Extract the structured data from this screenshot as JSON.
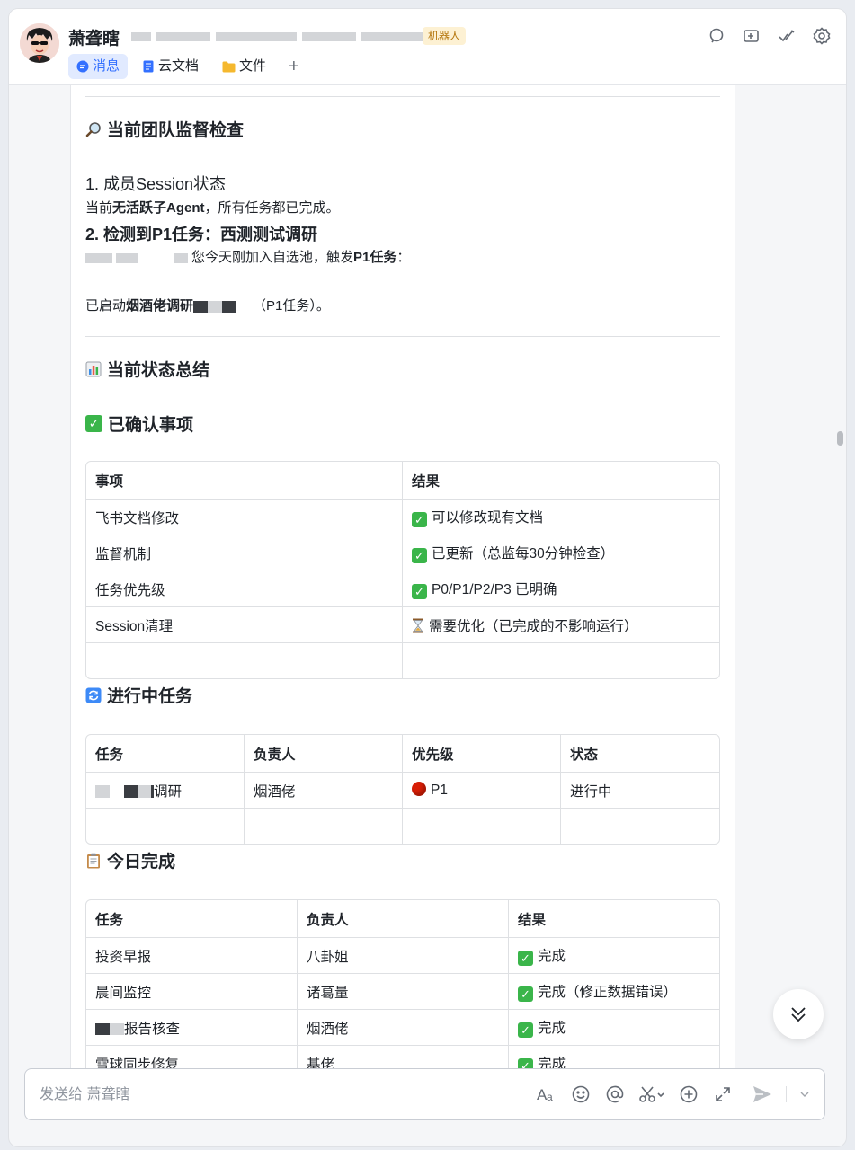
{
  "header": {
    "title": "萧聋瞎",
    "id_text": "oc_2••••••4da•••••••••••••••••12•••••a52••",
    "bot_badge": "机器人",
    "tabs": [
      {
        "label": "消息",
        "icon": "chat-bubble-icon"
      },
      {
        "label": "云文档",
        "icon": "doc-icon"
      },
      {
        "label": "文件",
        "icon": "folder-icon"
      }
    ],
    "add_tab": "+"
  },
  "message": {
    "section1_title": "当前团队监督检查",
    "item1_title": "1. 成员Session状态",
    "item1_pre": "当前",
    "item1_bold": "无活跃子Agent",
    "item1_post": "，所有任务都已完成。",
    "item2_title": "2. 检测到P1任务：西测测试调研",
    "item2_pre": "您今天刚加入自选池，触发",
    "item2_bold": "P1任务",
    "item2_post": "：",
    "started_pre": "已启动",
    "started_bold": "烟酒佬调研",
    "started_post": "（P1任务）。",
    "section2_title": "当前状态总结",
    "confirmed_title": "已确认事项",
    "confirmed_table": {
      "headers": [
        "事项",
        "结果"
      ],
      "rows": [
        [
          "飞书文档修改",
          "可以修改现有文档"
        ],
        [
          "监督机制",
          "已更新（总监每30分钟检查）"
        ],
        [
          "任务优先级",
          "P0/P1/P2/P3 已明确"
        ],
        [
          "Session清理",
          "需要优化（已完成的不影响运行）"
        ]
      ]
    },
    "inprogress_title": "进行中任务",
    "inprogress_table": {
      "headers": [
        "任务",
        "负责人",
        "优先级",
        "状态"
      ],
      "rows": [
        [
          "调研",
          "烟酒佬",
          "P1",
          "进行中"
        ]
      ]
    },
    "done_title": "今日完成",
    "done_table": {
      "headers": [
        "任务",
        "负责人",
        "结果"
      ],
      "rows": [
        [
          "投资早报",
          "八卦姐",
          "完成"
        ],
        [
          "晨间监控",
          "诸葛量",
          "完成（修正数据错误）"
        ],
        [
          "报告核查",
          "烟酒佬",
          "完成"
        ],
        [
          "雪球同步修复",
          "基佬",
          "完成"
        ]
      ]
    }
  },
  "input": {
    "placeholder": "发送给 萧聋瞎",
    "tools": [
      "format-icon",
      "emoji-icon",
      "mention-icon",
      "scissors-icon",
      "add-icon",
      "expand-icon",
      "send-icon"
    ]
  },
  "colors": {
    "accent": "#3370ff",
    "check_green": "#3ab54a",
    "p1_red": "#d81e06",
    "badge_bg": "#fdf1d3"
  }
}
